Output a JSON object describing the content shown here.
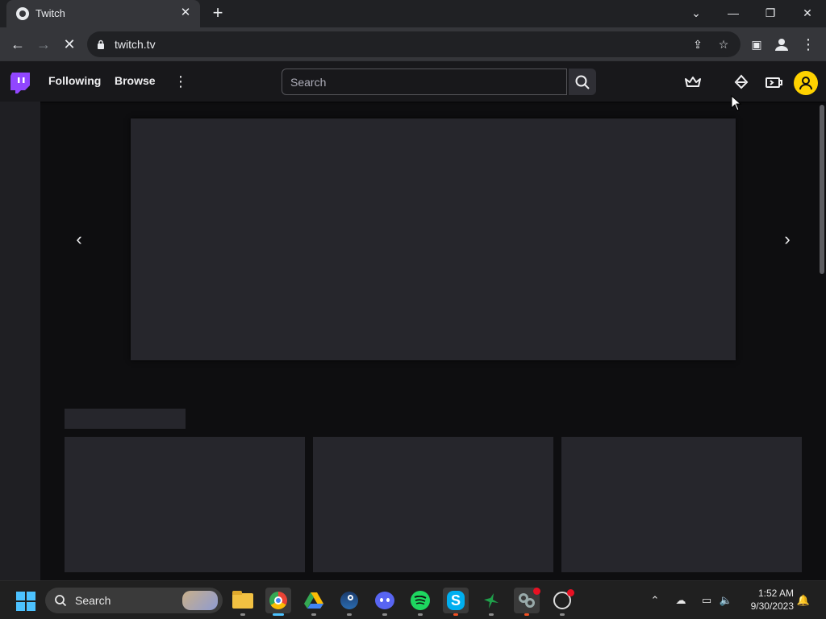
{
  "browser": {
    "tab": {
      "title": "Twitch",
      "favicon": "chrome-favicon",
      "close_icon": "close-icon"
    },
    "new_tab_icon": "plus-icon",
    "window_controls": {
      "dropdown": "chevron-down-icon",
      "minimize": "minimize-icon",
      "restore": "restore-icon",
      "close": "close-icon"
    },
    "url": "twitch.tv",
    "toolbar_icons": [
      "share-icon",
      "star-icon",
      "side-panel-icon",
      "profile-icon",
      "kebab-menu-icon"
    ]
  },
  "twitch": {
    "nav": {
      "following": "Following",
      "browse": "Browse"
    },
    "search": {
      "placeholder": "Search"
    },
    "colors": {
      "brand": "#9146ff",
      "avatar": "#ffd200",
      "background": "#0e0e10",
      "nav": "#18181b",
      "placeholder_block": "#26262c"
    },
    "right_icons": [
      "prime-crown-icon",
      "drops-icon",
      "bits-icon",
      "user-avatar-icon"
    ]
  },
  "taskbar": {
    "search_label": "Search",
    "apps": [
      "file-explorer-icon",
      "chrome-icon",
      "google-drive-icon",
      "steam-icon",
      "discord-icon",
      "spotify-icon",
      "skype-icon",
      "hummingbird-app-icon",
      "link-app-icon",
      "obs-icon"
    ],
    "clock": {
      "time": "1:52 AM",
      "date": "9/30/2023"
    }
  }
}
